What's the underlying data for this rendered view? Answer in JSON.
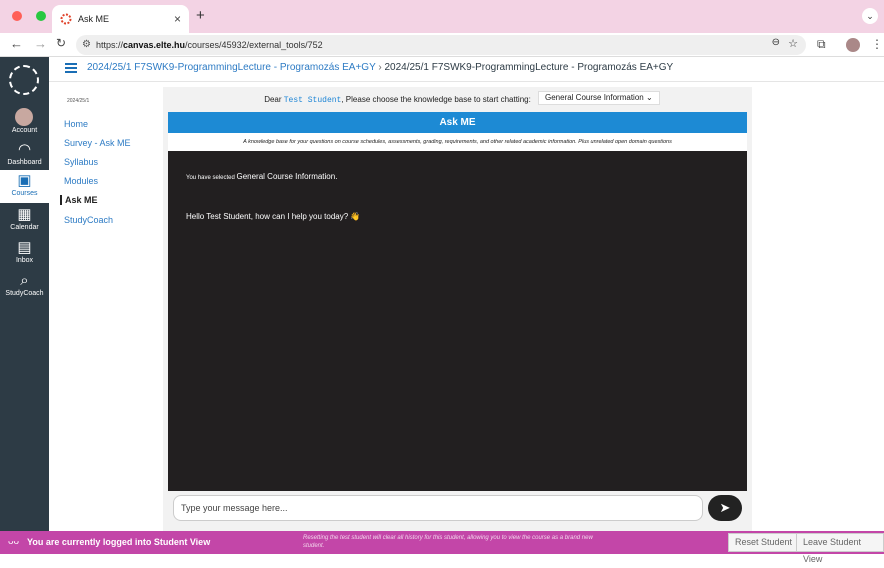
{
  "browser": {
    "tab_title": "Ask ME",
    "tab_close": "×",
    "new_tab": "+",
    "url_prefix": "https://",
    "url_domain": "canvas.elte.hu",
    "url_path": "/courses/45932/external_tools/752"
  },
  "breadcrumb": {
    "course": "2024/25/1 F7SWK9-ProgrammingLecture - Programozás EA+GY",
    "separator": "›",
    "current": "2024/25/1 F7SWK9-ProgrammingLecture - Programozás EA+GY"
  },
  "global_nav": {
    "items": [
      {
        "label": "Account",
        "icon": "user-avatar"
      },
      {
        "label": "Dashboard",
        "icon": "speedometer-icon"
      },
      {
        "label": "Courses",
        "icon": "book-icon"
      },
      {
        "label": "Calendar",
        "icon": "calendar-icon"
      },
      {
        "label": "Inbox",
        "icon": "inbox-icon"
      },
      {
        "label": "StudyCoach",
        "icon": "search-icon"
      }
    ]
  },
  "course_nav": {
    "term": "2024/25/1",
    "items": [
      "Home",
      "Survey - Ask ME",
      "Syllabus",
      "Modules",
      "Ask ME",
      "StudyCoach"
    ]
  },
  "chat": {
    "greeting_pre": "Dear ",
    "student_name": "Test Student",
    "greeting_post": ", Please choose the knowledge base to start chatting:",
    "kb_selected": "General Course Information",
    "title": "Ask ME",
    "description": "A knowledge base for your questions on course schedules, assessments, grading, requirements, and other related academic information. Plus unrelated open domain questions",
    "selected_msg_pre": "You have selected ",
    "selected_msg_kb": "General Course Information.",
    "hello_msg": "Hello Test Student, how can I help you today? 👋",
    "input_placeholder": "Type your message here..."
  },
  "student_bar": {
    "message": "You are currently logged into Student View",
    "note": "Resetting the test student will clear all history for this student, allowing you to view the course as a brand new student.",
    "reset_label": "Reset Student",
    "leave_label": "Leave Student View"
  },
  "colors": {
    "accent": "#1d8ad4",
    "global_nav": "#2d3b45",
    "student_bar": "#c346a8",
    "chat_bg": "#221f20"
  }
}
